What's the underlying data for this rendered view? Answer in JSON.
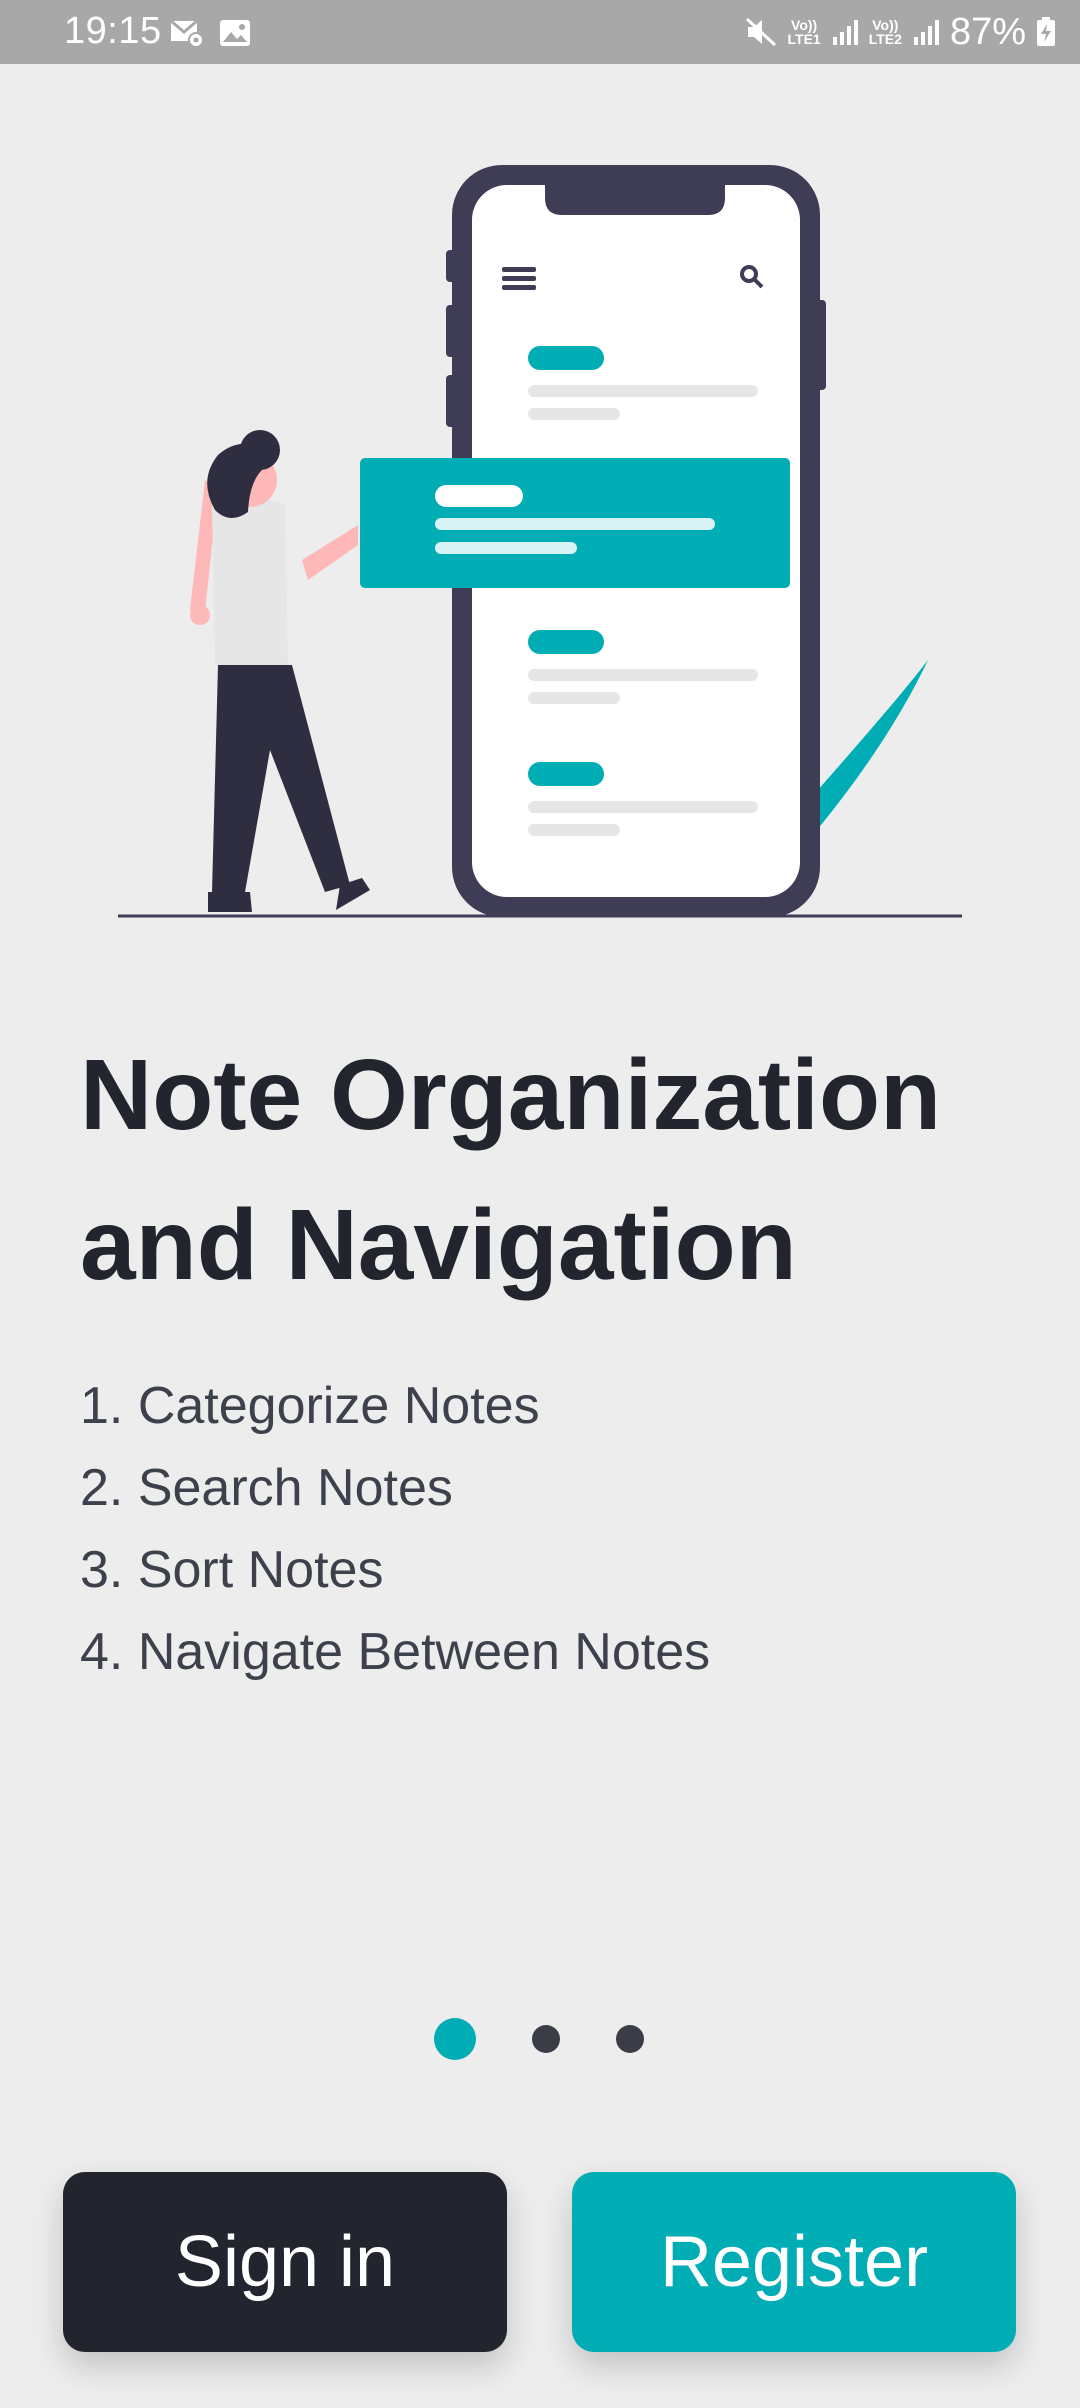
{
  "status_bar": {
    "time": "19:15",
    "left_icons": [
      "email-settings-icon",
      "gallery-icon"
    ],
    "right_icons": [
      "mute-icon",
      "sim1-signal-icon",
      "sim2-signal-icon",
      "battery-charging-icon"
    ],
    "sim1_label_top": "Vo))",
    "sim1_label_bottom": "LTE1",
    "sim2_label_top": "Vo))",
    "sim2_label_bottom": "LTE2",
    "battery": "87%"
  },
  "colors": {
    "accent": "#00adb5",
    "dark": "#22252e",
    "background": "#ededed"
  },
  "onboarding": {
    "title_line1": "Note Organization",
    "title_line2": "and Navigation",
    "features": [
      "1. Categorize Notes",
      "2. Search Notes",
      "3. Sort Notes",
      "4. Navigate Between Notes"
    ],
    "page_count": 3,
    "current_page": 1
  },
  "actions": {
    "signin_label": "Sign in",
    "register_label": "Register"
  }
}
